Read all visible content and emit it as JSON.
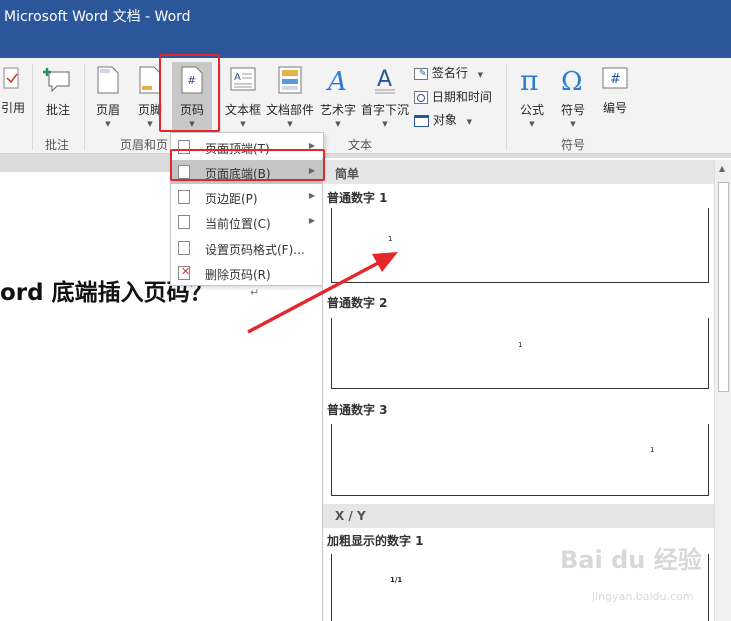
{
  "window": {
    "title": "Microsoft Word 文档 - Word"
  },
  "ribbon": {
    "buttons": {
      "cross_ref": "引用",
      "comment": "批注",
      "header": "页眉",
      "footer": "页脚",
      "page_number": "页码",
      "textbox": "文本框",
      "quick_parts": "文档部件",
      "wordart": "艺术字",
      "dropcap": "首字下沉",
      "signature_line": "签名行",
      "date_time": "日期和时间",
      "object": "对象",
      "equation": "公式",
      "symbol": "符号",
      "number": "编号"
    },
    "groups": {
      "comments": "批注",
      "header_footer": "页眉和页",
      "text": "文本",
      "symbols": "符号"
    }
  },
  "menu": {
    "items": [
      {
        "label": "页面顶端(T)"
      },
      {
        "label": "页面底端(B)"
      },
      {
        "label": "页边距(P)"
      },
      {
        "label": "当前位置(C)"
      },
      {
        "label": "设置页码格式(F)..."
      },
      {
        "label": "删除页码(R)"
      }
    ]
  },
  "document": {
    "heading": "ord 底端插入页码？"
  },
  "gallery": {
    "section_simple": "简单",
    "section_xy": "X / Y",
    "items": [
      {
        "label": "普通数字 1",
        "sample": "1"
      },
      {
        "label": "普通数字 2",
        "sample": "1"
      },
      {
        "label": "普通数字 3",
        "sample": "1"
      },
      {
        "label": "加粗显示的数字 1",
        "sample": "1/1"
      }
    ]
  },
  "watermark": {
    "text": "Bai du 经验",
    "url": "jingyan.baidu.com"
  },
  "colors": {
    "titlebar": "#2b579a",
    "highlight": "#e5262a",
    "ribbon_bg": "#f3f3f3"
  }
}
